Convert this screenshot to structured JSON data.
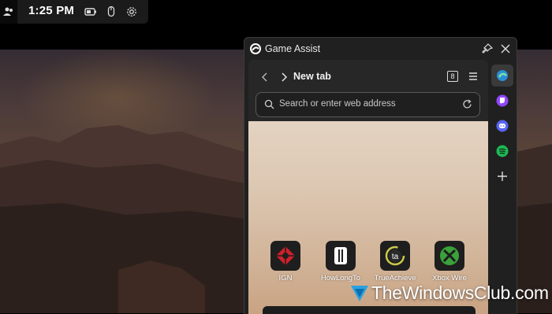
{
  "status_bar": {
    "time": "1:25 PM",
    "icons": [
      "people-icon",
      "battery-icon",
      "mouse-icon",
      "settings-icon"
    ]
  },
  "panel": {
    "title": "Game Assist",
    "icons": [
      "game-assist-logo",
      "pin-icon",
      "close-icon"
    ]
  },
  "browser": {
    "tab_title": "New tab",
    "tab_count": "8",
    "search_placeholder": "Search or enter web address",
    "icons": [
      "back-arrow-icon",
      "forward-arrow-icon",
      "tabs-icon",
      "menu-icon",
      "search-icon",
      "refresh-icon"
    ]
  },
  "quick_links": [
    {
      "label": "IGN",
      "icon": "ign-icon",
      "color": "#d0202a"
    },
    {
      "label": "HowLongTo",
      "icon": "howlongtobeat-icon",
      "color": "#ffffff"
    },
    {
      "label": "TrueAchieve",
      "icon": "trueachievements-icon",
      "color": "#c9c94a"
    },
    {
      "label": "Xbox Wire",
      "icon": "xbox-icon",
      "color": "#3aa23a"
    }
  ],
  "sidebar": {
    "items": [
      "edge-icon",
      "twitch-icon",
      "discord-icon",
      "spotify-icon",
      "add-icon"
    ],
    "colors": {
      "twitch": "#9147ff",
      "discord": "#5865f2",
      "spotify": "#1db954"
    }
  },
  "watermark": {
    "text": "TheWindowsClub.com"
  }
}
